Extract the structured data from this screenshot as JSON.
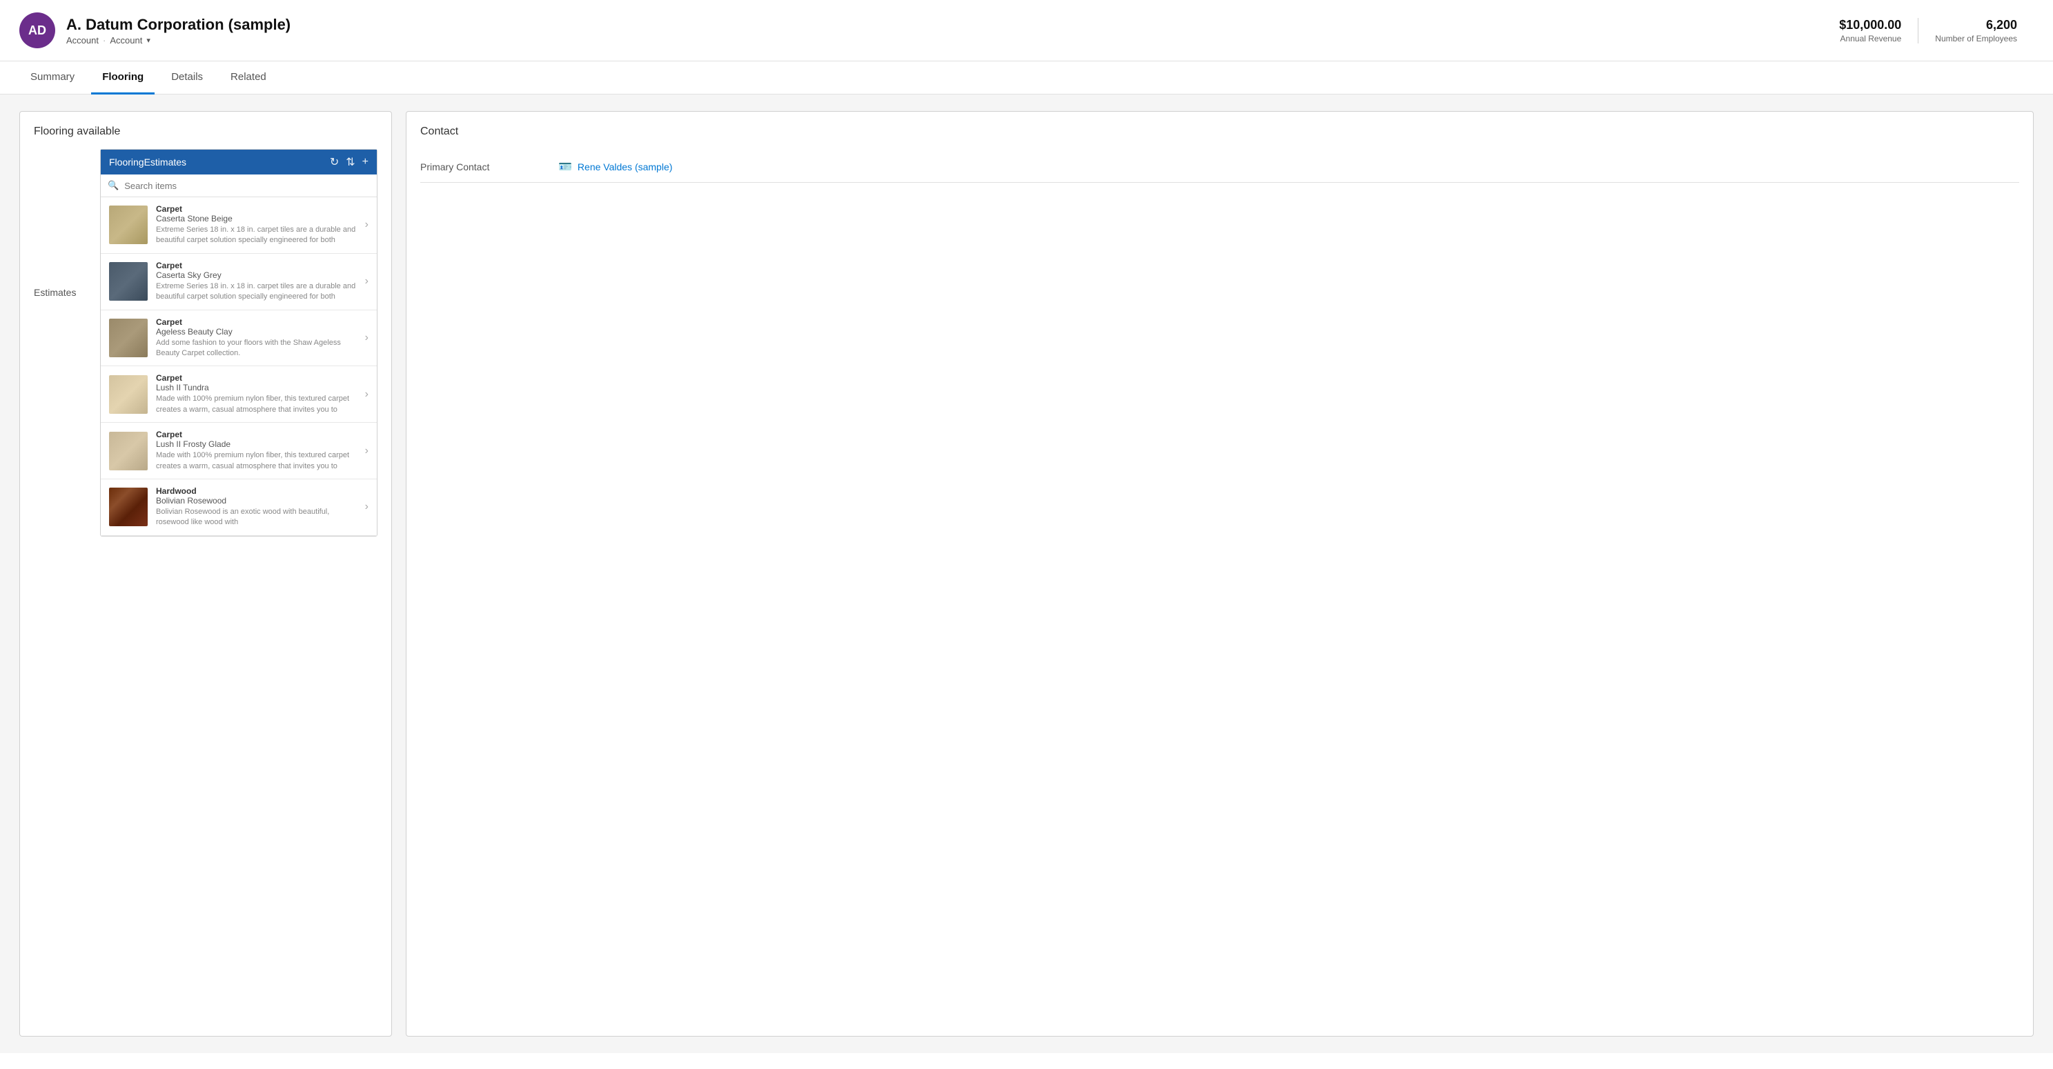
{
  "header": {
    "avatar_initials": "AD",
    "title": "A. Datum Corporation (sample)",
    "breadcrumb1": "Account",
    "breadcrumb2": "Account",
    "annual_revenue_value": "$10,000.00",
    "annual_revenue_label": "Annual Revenue",
    "employees_value": "6,200",
    "employees_label": "Number of Employees"
  },
  "nav": {
    "tabs": [
      {
        "id": "summary",
        "label": "Summary",
        "active": false
      },
      {
        "id": "flooring",
        "label": "Flooring",
        "active": true
      },
      {
        "id": "details",
        "label": "Details",
        "active": false
      },
      {
        "id": "related",
        "label": "Related",
        "active": false
      }
    ]
  },
  "left_panel": {
    "title": "Flooring available",
    "estimates_label": "Estimates",
    "flooring_header": "FlooringEstimates",
    "search_placeholder": "Search items",
    "products": [
      {
        "category": "Carpet",
        "name": "Caserta Stone Beige",
        "desc": "Extreme Series 18 in. x 18 in. carpet tiles are a durable and beautiful carpet solution specially engineered for both",
        "texture": "carpet-beige"
      },
      {
        "category": "Carpet",
        "name": "Caserta Sky Grey",
        "desc": "Extreme Series 18 in. x 18 in. carpet tiles are a durable and beautiful carpet solution specially engineered for both",
        "texture": "carpet-grey"
      },
      {
        "category": "Carpet",
        "name": "Ageless Beauty Clay",
        "desc": "Add some fashion to your floors with the Shaw Ageless Beauty Carpet collection.",
        "texture": "carpet-clay"
      },
      {
        "category": "Carpet",
        "name": "Lush II Tundra",
        "desc": "Made with 100% premium nylon fiber, this textured carpet creates a warm, casual atmosphere that invites you to",
        "texture": "carpet-tundra"
      },
      {
        "category": "Carpet",
        "name": "Lush II Frosty Glade",
        "desc": "Made with 100% premium nylon fiber, this textured carpet creates a warm, casual atmosphere that invites you to",
        "texture": "carpet-frosty"
      },
      {
        "category": "Hardwood",
        "name": "Bolivian Rosewood",
        "desc": "Bolivian Rosewood is an exotic wood with beautiful, rosewood like wood with",
        "texture": "hardwood-rosewood"
      }
    ]
  },
  "right_panel": {
    "title": "Contact",
    "primary_contact_label": "Primary Contact",
    "primary_contact_name": "Rene Valdes (sample)"
  }
}
